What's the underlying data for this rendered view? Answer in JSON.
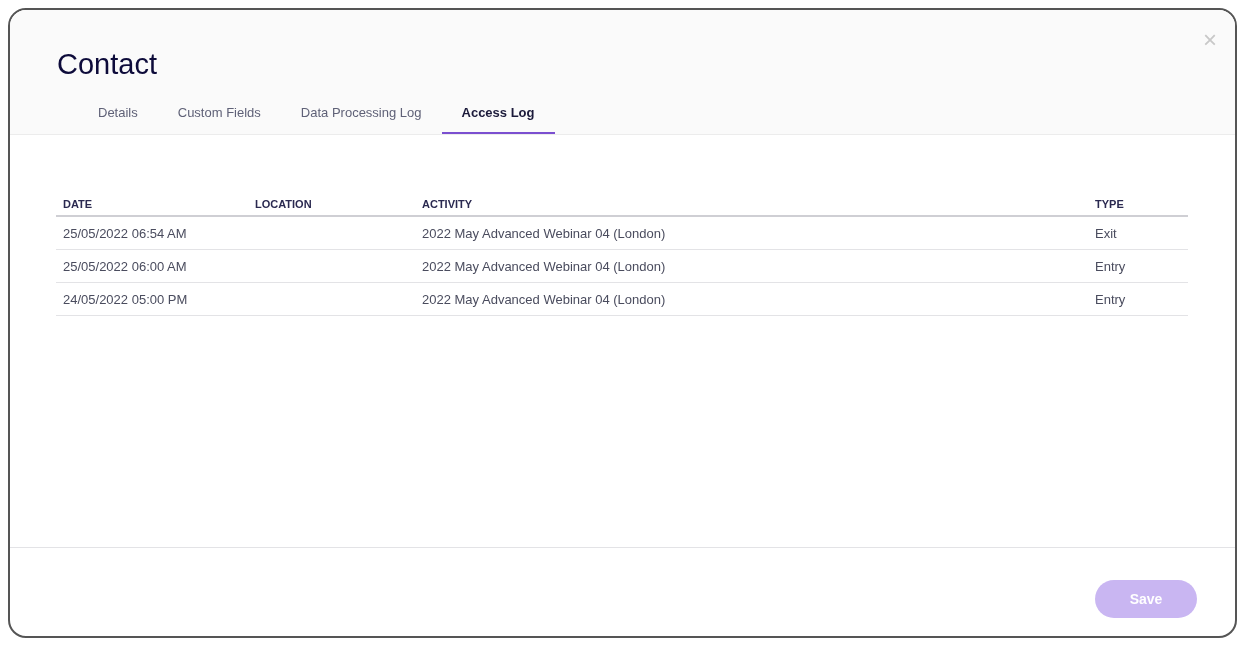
{
  "dialog": {
    "title": "Contact",
    "close": "×"
  },
  "tabs": [
    {
      "label": "Details",
      "selected": false
    },
    {
      "label": "Custom Fields",
      "selected": false
    },
    {
      "label": "Data Processing Log",
      "selected": false
    },
    {
      "label": "Access Log",
      "selected": true
    }
  ],
  "table": {
    "columns": [
      "DATE",
      "LOCATION",
      "ACTIVITY",
      "TYPE"
    ],
    "rows": [
      [
        "25/05/2022 06:54 AM",
        "",
        "2022 May Advanced Webinar 04 (London)",
        "Exit"
      ],
      [
        "25/05/2022 06:00 AM",
        "",
        "2022 May Advanced Webinar 04 (London)",
        "Entry"
      ],
      [
        "24/05/2022 05:00 PM",
        "",
        "2022 May Advanced Webinar 04 (London)",
        "Entry"
      ]
    ]
  },
  "save_button": {
    "label": "Save",
    "disabled": true
  }
}
